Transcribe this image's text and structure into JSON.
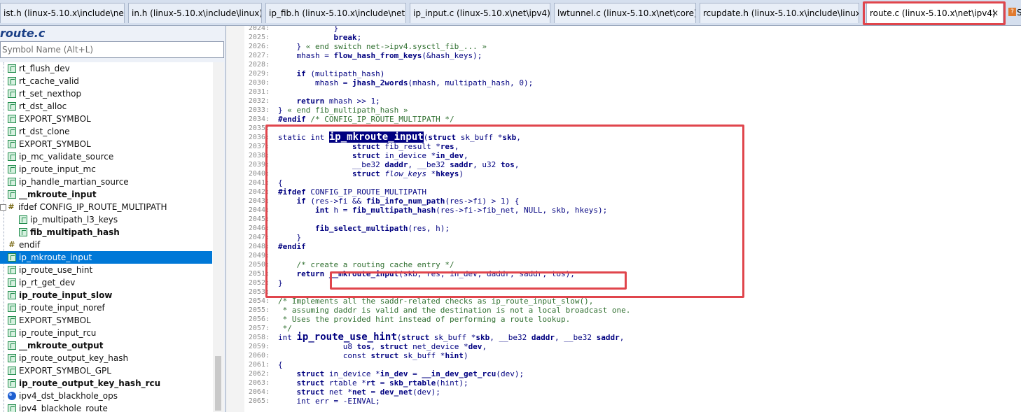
{
  "tabs": [
    {
      "label": "ist.h (linux-5.10.x\\include\\net)",
      "active": false
    },
    {
      "label": "in.h (linux-5.10.x\\include\\linux)",
      "active": false
    },
    {
      "label": "ip_fib.h (linux-5.10.x\\include\\net)",
      "active": false
    },
    {
      "label": "ip_input.c (linux-5.10.x\\net\\ipv4)",
      "active": false
    },
    {
      "label": "lwtunnel.c (linux-5.10.x\\net\\core)",
      "active": false
    },
    {
      "label": "rcupdate.h (linux-5.10.x\\include\\linux)",
      "active": false
    },
    {
      "label": "route.c (linux-5.10.x\\net\\ipv4)",
      "active": true
    }
  ],
  "tab_close_glyph": "✕",
  "tab_overflow_text": "S",
  "panel": {
    "title": "route.c",
    "search_placeholder": "Symbol Name (Alt+L)"
  },
  "symbols": [
    {
      "label": "rt_flush_dev",
      "icon": "function-icon",
      "bold": false,
      "indent": 1
    },
    {
      "label": "rt_cache_valid",
      "icon": "function-icon",
      "bold": false,
      "indent": 1
    },
    {
      "label": "rt_set_nexthop",
      "icon": "function-icon",
      "bold": false,
      "indent": 1
    },
    {
      "label": "rt_dst_alloc",
      "icon": "function-icon",
      "bold": false,
      "indent": 1
    },
    {
      "label": "EXPORT_SYMBOL",
      "icon": "function-icon",
      "bold": false,
      "indent": 1
    },
    {
      "label": "rt_dst_clone",
      "icon": "function-icon",
      "bold": false,
      "indent": 1
    },
    {
      "label": "EXPORT_SYMBOL",
      "icon": "function-icon",
      "bold": false,
      "indent": 1
    },
    {
      "label": "ip_mc_validate_source",
      "icon": "function-icon",
      "bold": false,
      "indent": 1
    },
    {
      "label": "ip_route_input_mc",
      "icon": "function-icon",
      "bold": false,
      "indent": 1
    },
    {
      "label": "ip_handle_martian_source",
      "icon": "function-icon",
      "bold": false,
      "indent": 1
    },
    {
      "label": "__mkroute_input",
      "icon": "function-icon",
      "bold": true,
      "indent": 1
    },
    {
      "label": "ifdef CONFIG_IP_ROUTE_MULTIPATH",
      "icon": "hash-icon",
      "bold": false,
      "indent": 0
    },
    {
      "label": "ip_multipath_l3_keys",
      "icon": "function-icon",
      "bold": false,
      "indent": 2
    },
    {
      "label": "fib_multipath_hash",
      "icon": "function-icon",
      "bold": true,
      "indent": 2
    },
    {
      "label": "endif",
      "icon": "hash-icon",
      "bold": false,
      "indent": 1
    },
    {
      "label": "ip_mkroute_input",
      "icon": "function-icon",
      "bold": false,
      "indent": 1,
      "selected": true
    },
    {
      "label": "ip_route_use_hint",
      "icon": "function-icon",
      "bold": false,
      "indent": 1
    },
    {
      "label": "ip_rt_get_dev",
      "icon": "function-icon",
      "bold": false,
      "indent": 1
    },
    {
      "label": "ip_route_input_slow",
      "icon": "function-icon",
      "bold": true,
      "indent": 1
    },
    {
      "label": "ip_route_input_noref",
      "icon": "function-icon",
      "bold": false,
      "indent": 1
    },
    {
      "label": "EXPORT_SYMBOL",
      "icon": "function-icon",
      "bold": false,
      "indent": 1
    },
    {
      "label": "ip_route_input_rcu",
      "icon": "function-icon",
      "bold": false,
      "indent": 1
    },
    {
      "label": "__mkroute_output",
      "icon": "function-icon",
      "bold": true,
      "indent": 1
    },
    {
      "label": "ip_route_output_key_hash",
      "icon": "function-icon",
      "bold": false,
      "indent": 1
    },
    {
      "label": "EXPORT_SYMBOL_GPL",
      "icon": "function-icon",
      "bold": false,
      "indent": 1
    },
    {
      "label": "ip_route_output_key_hash_rcu",
      "icon": "function-icon",
      "bold": true,
      "indent": 1
    },
    {
      "label": "ipv4_dst_blackhole_ops",
      "icon": "variable-icon",
      "bold": false,
      "indent": 1
    },
    {
      "label": "ipv4_blackhole_route",
      "icon": "function-icon",
      "bold": false,
      "indent": 1
    }
  ],
  "code_lines": [
    {
      "ln": "2024:",
      "html": "            }"
    },
    {
      "ln": "2025:",
      "html": "            <span class='kw'>break</span>;"
    },
    {
      "ln": "2026:",
      "html": "    } <span class='cm'>« end switch net-&gt;ipv4.sysctl_fib_... »</span>"
    },
    {
      "ln": "2027:",
      "html": "    mhash = <span class='fn'>flow_hash_from_keys</span>(&amp;hash_keys);"
    },
    {
      "ln": "2028:",
      "html": ""
    },
    {
      "ln": "2029:",
      "html": "    <span class='kw'>if</span> (multipath_hash)"
    },
    {
      "ln": "2030:",
      "html": "        mhash = <span class='fn'>jhash_2words</span>(mhash, multipath_hash, 0);"
    },
    {
      "ln": "2031:",
      "html": ""
    },
    {
      "ln": "2032:",
      "html": "    <span class='kw'>return</span> mhash &gt;&gt; 1;"
    },
    {
      "ln": "2033:",
      "html": "} <span class='cm'>« end fib_multipath_hash »</span>"
    },
    {
      "ln": "2034:",
      "html": "<span class='kw'>#endif</span> <span class='cm'>/* CONFIG_IP_ROUTE_MULTIPATH */</span>"
    },
    {
      "ln": "2035:",
      "html": ""
    },
    {
      "ln": "2036:",
      "html": "static int <span class='hl-sel' style='font-size:14px;font-weight:bold'>ip_mkroute_input</span>(<span class='kw'>struct</span> sk_buff *<b>skb</b>,"
    },
    {
      "ln": "2037:",
      "html": "                <span class='kw'>struct</span> fib_result *<b>res</b>,"
    },
    {
      "ln": "2038:",
      "html": "                <span class='kw'>struct</span> in_device *<b>in_dev</b>,"
    },
    {
      "ln": "2039:",
      "html": "                __be32 <b>daddr</b>, __be32 <b>saddr</b>, u32 <b>tos</b>,"
    },
    {
      "ln": "2040:",
      "html": "                <span class='kw'>struct</span> <i>flow_keys</i> *<b>hkeys</b>)"
    },
    {
      "ln": "2041:",
      "html": "{"
    },
    {
      "ln": "2042:",
      "html": "<span class='kw'>#ifdef</span> CONFIG_IP_ROUTE_MULTIPATH"
    },
    {
      "ln": "2043:",
      "html": "    <span class='kw'>if</span> (res-&gt;fi &amp;&amp; <span class='fn'>fib_info_num_path</span>(res-&gt;fi) &gt; 1) {"
    },
    {
      "ln": "2044:",
      "html": "        <span class='kw'>int</span> h = <span class='fn'>fib_multipath_hash</span>(res-&gt;fi-&gt;fib_net, NULL, skb, hkeys);"
    },
    {
      "ln": "2045:",
      "html": ""
    },
    {
      "ln": "2046:",
      "html": "        <span class='fn'>fib_select_multipath</span>(res, h);"
    },
    {
      "ln": "2047:",
      "html": "    }"
    },
    {
      "ln": "2048:",
      "html": "<span class='kw'>#endif</span>"
    },
    {
      "ln": "2049:",
      "html": ""
    },
    {
      "ln": "2050:",
      "html": "    <span class='cm'>/* create a routing cache entry */</span>"
    },
    {
      "ln": "2051:",
      "html": "    <span class='kw'>return</span> <span class='fn'>__mkroute_input</span>(skb, res, in_dev, daddr, saddr, tos);"
    },
    {
      "ln": "2052:",
      "html": "}"
    },
    {
      "ln": "2053:",
      "html": ""
    },
    {
      "ln": "2054:",
      "html": "<span class='cm'>/* Implements all the saddr-related checks as ip_route_input_slow(),</span>"
    },
    {
      "ln": "2055:",
      "html": "<span class='cm'> * assuming daddr is valid and the destination is not a local broadcast one.</span>"
    },
    {
      "ln": "2056:",
      "html": "<span class='cm'> * Uses the provided hint instead of performing a route lookup.</span>"
    },
    {
      "ln": "2057:",
      "html": "<span class='cm'> */</span>"
    },
    {
      "ln": "2058:",
      "html": "int <span style='font-size:14px;font-weight:bold'>ip_route_use_hint</span>(<span class='kw'>struct</span> sk_buff *<b>skb</b>, __be32 <b>daddr</b>, __be32 <b>saddr</b>,"
    },
    {
      "ln": "2059:",
      "html": "              u8 <b>tos</b>, <span class='kw'>struct</span> net_device *<b>dev</b>,"
    },
    {
      "ln": "2060:",
      "html": "              const <span class='kw'>struct</span> sk_buff *<b>hint</b>)"
    },
    {
      "ln": "2061:",
      "html": "{"
    },
    {
      "ln": "2062:",
      "html": "    <span class='kw'>struct</span> in_device *<b>in_dev</b> = <span class='fn'>__in_dev_get_rcu</span>(dev);"
    },
    {
      "ln": "2063:",
      "html": "    <span class='kw'>struct</span> rtable *<b>rt</b> = <span class='fn'>skb_rtable</span>(hint);"
    },
    {
      "ln": "2064:",
      "html": "    <span class='kw'>struct</span> net *<b>net</b> = <span class='fn'>dev_net</span>(dev);"
    },
    {
      "ln": "2065:",
      "html": "    int err = -EINVAL;"
    }
  ]
}
